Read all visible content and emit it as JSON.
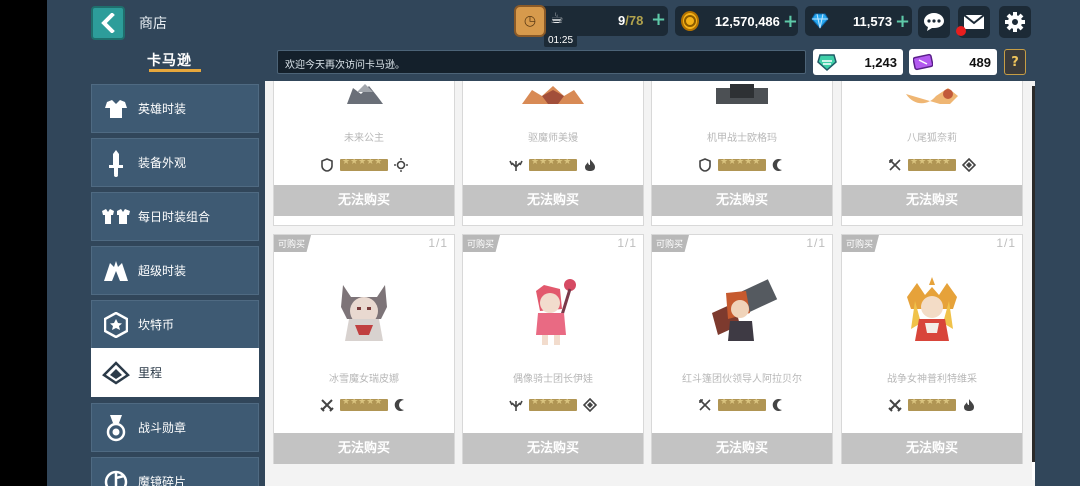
{
  "header": {
    "title": "商店",
    "stamina": {
      "current": "9",
      "max": "/78",
      "timer": "01:25"
    },
    "gold": "12,570,486",
    "gems": "11,573",
    "brand": "卡马逊",
    "notice": "欢迎今天再次访问卡马逊。",
    "mileage_tickets": "1,243",
    "purple_tickets": "489",
    "help": "?"
  },
  "sidebar": {
    "items": [
      {
        "label": "英雄时装",
        "icon": "costume-icon"
      },
      {
        "label": "装备外观",
        "icon": "sword-icon"
      },
      {
        "label": "每日时装组合",
        "icon": "outfit-set-icon"
      },
      {
        "label": "超级时装",
        "icon": "super-costume-icon"
      },
      {
        "label": "坎特币",
        "icon": "kanter-coin-icon"
      },
      {
        "label": "里程",
        "icon": "ticket-icon"
      },
      {
        "label": "战斗勋章",
        "icon": "medal-icon"
      },
      {
        "label": "魔镜碎片",
        "icon": "mirror-shard-icon"
      }
    ],
    "active_index": 5
  },
  "shop": {
    "buy_label": "无法购买",
    "purchasable_badge": "可购买",
    "row1": [
      {
        "name": "未来公主",
        "role": "shield-icon",
        "element": "sun-icon"
      },
      {
        "name": "驱魔师美嫚",
        "role": "claw-icon",
        "element": "fire-icon"
      },
      {
        "name": "机甲战士欧格玛",
        "role": "shield-icon",
        "element": "moon-icon"
      },
      {
        "name": "八尾狐奈莉",
        "role": "crossed-arrows-icon",
        "element": "diamond-icon"
      }
    ],
    "row2": [
      {
        "name": "冰雪魔女瑞皮娜",
        "role": "crossed-swords-icon",
        "element": "moon-icon",
        "qty": "1/1"
      },
      {
        "name": "偶像骑士团长伊娃",
        "role": "claw-icon",
        "element": "diamond-icon",
        "qty": "1/1"
      },
      {
        "name": "红斗篷团伙领导人阿拉贝尔",
        "role": "crossed-arrows-icon",
        "element": "moon-icon",
        "qty": "1/1"
      },
      {
        "name": "战争女神普利特维采",
        "role": "crossed-swords-icon",
        "element": "fire-icon",
        "qty": "1/1"
      }
    ]
  },
  "colors": {
    "header_bg": "#31465a",
    "back_btn": "#2d9d9a",
    "button_disabled": "#c3c3c3",
    "accent_gold": "#e7a73c"
  }
}
